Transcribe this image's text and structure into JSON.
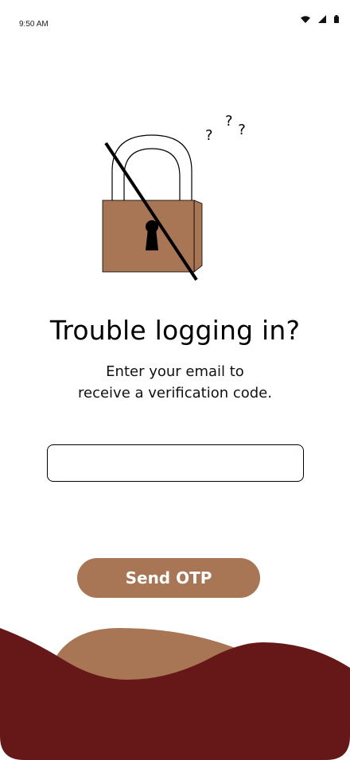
{
  "status_bar": {
    "time": "9:50 AM",
    "icons": [
      "wifi-icon",
      "cellular-signal-icon",
      "battery-icon"
    ]
  },
  "illustration": {
    "name": "crossed-out-padlock-with-question-marks",
    "question_marks": [
      "?",
      "?",
      "?"
    ]
  },
  "content": {
    "title": "Trouble logging in?",
    "subtitle_line1": "Enter your email to",
    "subtitle_line2": "receive a verification code."
  },
  "form": {
    "email_value": "",
    "email_placeholder": "",
    "send_button_label": "Send OTP"
  },
  "colors": {
    "accent_brown": "#a87555",
    "dark_maroon": "#661818",
    "white": "#ffffff"
  }
}
